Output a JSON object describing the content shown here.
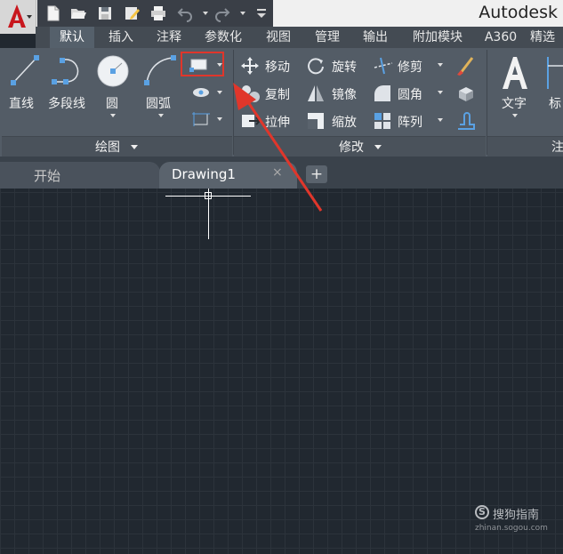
{
  "titlebar": {
    "app_title": "Autodesk",
    "qat": {
      "icons": [
        "new-icon",
        "open-icon",
        "save-icon",
        "save-as-icon",
        "print-icon",
        "undo-icon",
        "redo-icon",
        "qat-dropdown-icon"
      ]
    }
  },
  "ribbon": {
    "tabs": [
      {
        "label": "默认",
        "active": true
      },
      {
        "label": "插入"
      },
      {
        "label": "注释"
      },
      {
        "label": "参数化"
      },
      {
        "label": "视图"
      },
      {
        "label": "管理"
      },
      {
        "label": "输出"
      },
      {
        "label": "附加模块"
      },
      {
        "label": "A360"
      },
      {
        "label": "精选"
      }
    ],
    "draw": {
      "footer": "绘图",
      "line": "直线",
      "polyline": "多段线",
      "circle": "圆",
      "arc": "圆弧"
    },
    "modify": {
      "footer": "修改",
      "move": "移动",
      "rotate": "旋转",
      "trim": "修剪",
      "copy": "复制",
      "mirror": "镜像",
      "fillet": "圆角",
      "stretch": "拉伸",
      "scale": "缩放",
      "array": "阵列"
    },
    "annotation": {
      "text": "文字",
      "dim_partial": "标",
      "footer_partial": "注"
    }
  },
  "doctabs": {
    "start": "开始",
    "drawing": "Drawing1",
    "close": "×",
    "add": "+"
  },
  "watermark": {
    "name": "搜狗指南",
    "url": "zhinan.sogou.com",
    "logo": "S"
  },
  "colors": {
    "highlight": "#e0362b",
    "canvas": "#212830",
    "ribbon": "#535c66"
  }
}
